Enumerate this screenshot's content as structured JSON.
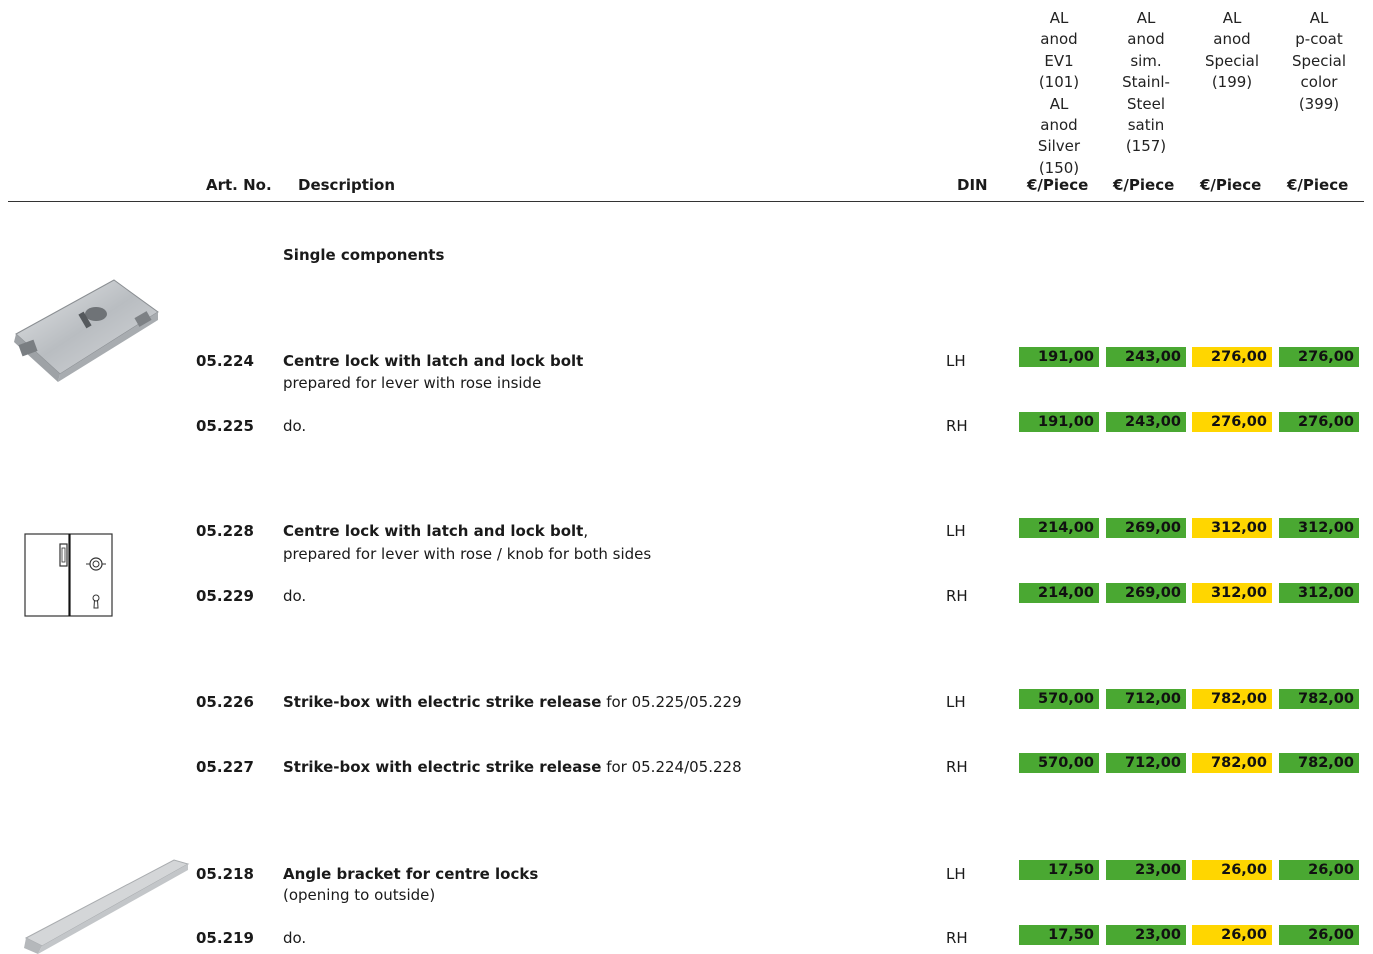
{
  "columns": [
    {
      "finish": "AL\nanod\nEV1\n(101)\nAL\nanod\nSilver\n(150)",
      "unit": "€/Piece"
    },
    {
      "finish": "AL\nanod\nsim.\nStainl-\nSteel\nsatin\n(157)",
      "unit": "€/Piece"
    },
    {
      "finish": "AL\nanod\nSpecial\n(199)",
      "unit": "€/Piece"
    },
    {
      "finish": "AL\np-coat\nSpecial\ncolor\n(399)",
      "unit": "€/Piece"
    }
  ],
  "headers": {
    "art_no": "Art. No.",
    "description": "Description",
    "din": "DIN"
  },
  "section_title": "Single components",
  "colors": {
    "green": "#4aa832",
    "yellow": "#ffd600"
  },
  "rows": [
    {
      "art_no": "05.224",
      "title": "Centre lock with latch and lock bolt",
      "suffix": "",
      "sub": "prepared for lever with rose inside",
      "din": "LH",
      "prices": [
        "191,00",
        "243,00",
        "276,00",
        "276,00"
      ]
    },
    {
      "art_no": "05.225",
      "title": "",
      "suffix": "do.",
      "sub": "",
      "din": "RH",
      "prices": [
        "191,00",
        "243,00",
        "276,00",
        "276,00"
      ]
    },
    {
      "art_no": "05.228",
      "title": "Centre lock with latch and lock bolt",
      "suffix": ",",
      "sub": "prepared for lever with rose / knob for both sides",
      "din": "LH",
      "prices": [
        "214,00",
        "269,00",
        "312,00",
        "312,00"
      ]
    },
    {
      "art_no": "05.229",
      "title": "",
      "suffix": "do.",
      "sub": "",
      "din": "RH",
      "prices": [
        "214,00",
        "269,00",
        "312,00",
        "312,00"
      ]
    },
    {
      "art_no": "05.226",
      "title": "Strike-box with electric strike release",
      "suffix": " for 05.225/05.229",
      "sub": "",
      "din": "LH",
      "prices": [
        "570,00",
        "712,00",
        "782,00",
        "782,00"
      ]
    },
    {
      "art_no": "05.227",
      "title": "Strike-box with electric strike release",
      "suffix": " for 05.224/05.228",
      "sub": "",
      "din": "RH",
      "prices": [
        "570,00",
        "712,00",
        "782,00",
        "782,00"
      ]
    },
    {
      "art_no": "05.218",
      "title": "Angle bracket for centre locks",
      "suffix": "",
      "sub": "(opening to outside)",
      "din": "LH",
      "prices": [
        "17,50",
        "23,00",
        "26,00",
        "26,00"
      ]
    },
    {
      "art_no": "05.219",
      "title": "",
      "suffix": "do.",
      "sub": "",
      "din": "RH",
      "prices": [
        "17,50",
        "23,00",
        "26,00",
        "26,00"
      ]
    }
  ],
  "images": [
    {
      "name": "centre-lock-photo"
    },
    {
      "name": "centre-lock-diagram"
    },
    {
      "name": "angle-bracket-photo"
    }
  ]
}
